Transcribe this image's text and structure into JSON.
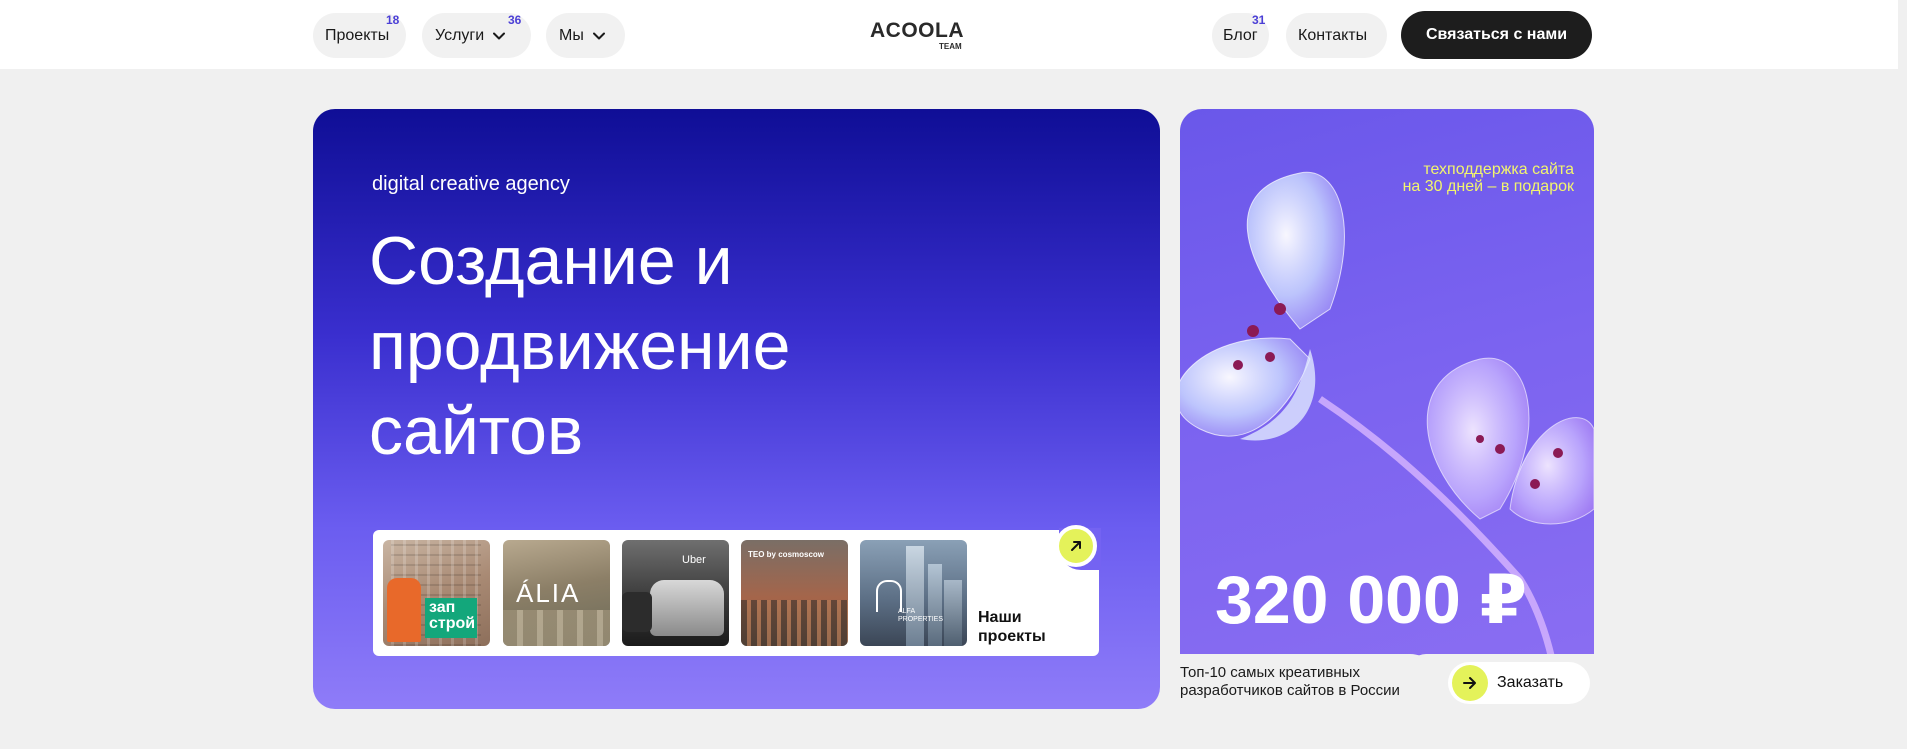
{
  "nav": {
    "left": [
      {
        "label": "Проекты",
        "count": "18",
        "dropdown": false
      },
      {
        "label": "Услуги",
        "count": "36",
        "dropdown": true
      },
      {
        "label": "Мы",
        "count": "",
        "dropdown": true
      }
    ],
    "right": [
      {
        "label": "Блог",
        "count": "31"
      },
      {
        "label": "Контакты",
        "count": ""
      }
    ],
    "logo": {
      "main": "ACOOLA",
      "sub": "TEAM"
    },
    "cta_label": "Связаться с нами",
    "count_color": "#4b3fd6"
  },
  "hero": {
    "kicker": "digital creative agency",
    "headline": "Создание и\nпродвижение\nсайтов",
    "projects": {
      "thumbnails": [
        {
          "name": "zapstroy",
          "label": "зап\nстрой"
        },
        {
          "name": "alia",
          "label": "ÁLIA"
        },
        {
          "name": "uber",
          "label": "Uber"
        },
        {
          "name": "teo-cosmoscow",
          "label": "TEO by cosmoscow"
        },
        {
          "name": "alfa-properties",
          "label": "ALFA PROPERTIES"
        }
      ],
      "label": "Наши\nпроекты",
      "icon": "arrow-up-right-icon"
    }
  },
  "promo": {
    "gift_text": "техподдержка сайта\nна 30 дней – в подарок",
    "price": "320 000 ₽",
    "tagline": "Топ-10 самых креативных\nразработчиков сайтов в России",
    "order_label": "Заказать",
    "accent": "#e4f25a"
  }
}
